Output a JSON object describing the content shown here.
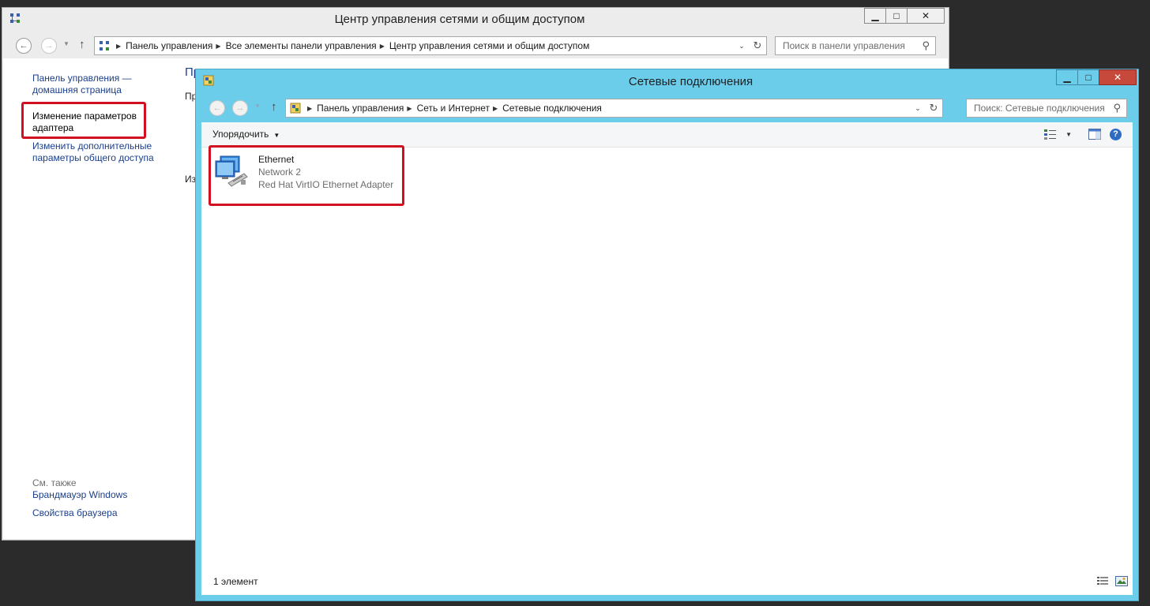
{
  "back_window": {
    "title": "Центр управления сетями и общим доступом",
    "address": [
      "Панель управления",
      "Все элементы панели управления",
      "Центр управления сетями и общим доступом"
    ],
    "search_placeholder": "Поиск в панели управления",
    "sidebar": {
      "home_link": [
        "Панель управления —",
        "домашняя страница"
      ],
      "adapter_link": [
        "Изменение параметров",
        "адаптера"
      ],
      "sharing_link": [
        "Изменить дополнительные",
        "параметры общего доступа"
      ],
      "see_also": "См. также",
      "firewall": "Брандмауэр Windows",
      "browser": "Свойства браузера"
    },
    "fragments": {
      "heading": "Пр",
      "line1": "Пр",
      "line2": "Из"
    }
  },
  "front_window": {
    "title": "Сетевые подключения",
    "address": [
      "Панель управления",
      "Сеть и Интернет",
      "Сетевые подключения"
    ],
    "search_placeholder": "Поиск: Сетевые подключения",
    "organize": "Упорядочить",
    "item": {
      "name": "Ethernet",
      "network": "Network  2",
      "adapter": "Red Hat VirtIO Ethernet Adapter"
    },
    "status": "1 элемент"
  },
  "colors": {
    "highlight": "#d01020",
    "front_frame": "#6ccdea",
    "link": "#1b3f8c",
    "close_button": "#c7493c"
  },
  "icons": [
    "network-center-icon",
    "back-icon",
    "forward-icon",
    "up-arrow-icon",
    "refresh-icon",
    "search-icon",
    "network-adapter-icon",
    "view-options-icon",
    "preview-pane-icon",
    "help-icon",
    "details-view-icon",
    "large-icons-view-icon"
  ]
}
